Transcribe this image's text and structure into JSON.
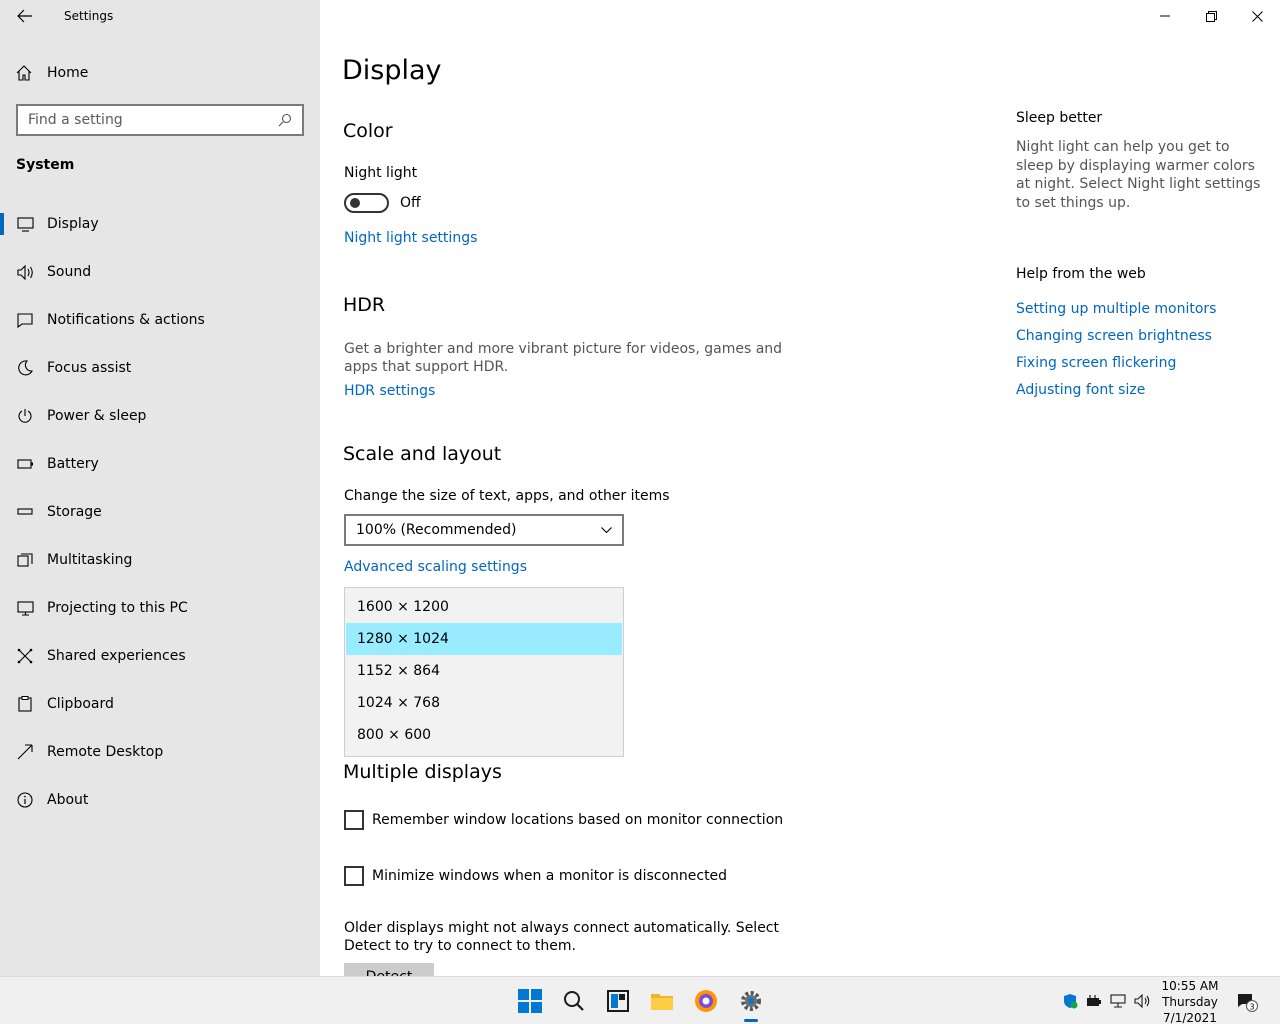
{
  "window": {
    "title": "Settings"
  },
  "sidebar": {
    "home_label": "Home",
    "search_placeholder": "Find a setting",
    "section": "System",
    "items": [
      {
        "label": "Display",
        "icon": "monitor-icon",
        "active": true
      },
      {
        "label": "Sound",
        "icon": "speaker-icon"
      },
      {
        "label": "Notifications & actions",
        "icon": "notification-icon"
      },
      {
        "label": "Focus assist",
        "icon": "moon-icon"
      },
      {
        "label": "Power & sleep",
        "icon": "power-icon"
      },
      {
        "label": "Battery",
        "icon": "battery-icon"
      },
      {
        "label": "Storage",
        "icon": "storage-icon"
      },
      {
        "label": "Multitasking",
        "icon": "multitasking-icon"
      },
      {
        "label": "Projecting to this PC",
        "icon": "projecting-icon"
      },
      {
        "label": "Shared experiences",
        "icon": "shared-icon"
      },
      {
        "label": "Clipboard",
        "icon": "clipboard-icon"
      },
      {
        "label": "Remote Desktop",
        "icon": "remote-desktop-icon"
      },
      {
        "label": "About",
        "icon": "info-icon"
      }
    ]
  },
  "main": {
    "title": "Display",
    "color": {
      "heading": "Color",
      "night_light_label": "Night light",
      "night_light_state": "Off",
      "night_light_link": "Night light settings"
    },
    "hdr": {
      "heading": "HDR",
      "description": "Get a brighter and more vibrant picture for videos, games and apps that support HDR.",
      "link": "HDR settings"
    },
    "scale": {
      "heading": "Scale and layout",
      "label": "Change the size of text, apps, and other items",
      "selected": "100% (Recommended)",
      "advanced_link": "Advanced scaling settings",
      "resolutions": [
        "1600 × 1200",
        "1280 × 1024",
        "1152 × 864",
        "1024 × 768",
        "800 × 600"
      ],
      "selected_resolution": "1280 × 1024"
    },
    "multiple": {
      "heading": "Multiple displays",
      "remember_label": "Remember window locations based on monitor connection",
      "minimize_label": "Minimize windows when a monitor is disconnected",
      "older_text": "Older displays might not always connect automatically. Select Detect to try to connect to them.",
      "detect_label": "Detect"
    }
  },
  "side": {
    "sleep_heading": "Sleep better",
    "sleep_desc": "Night light can help you get to sleep by displaying warmer colors at night. Select Night light settings to set things up.",
    "help_heading": "Help from the web",
    "help_links": [
      "Setting up multiple monitors",
      "Changing screen brightness",
      "Fixing screen flickering",
      "Adjusting font size"
    ]
  },
  "taskbar": {
    "time": "10:55 AM",
    "day": "Thursday",
    "date": "7/1/2021",
    "notification_count": "3"
  },
  "colors": {
    "accent": "#0067c0",
    "selection": "#99ebff",
    "sidebar_bg": "#e6e6e6"
  }
}
